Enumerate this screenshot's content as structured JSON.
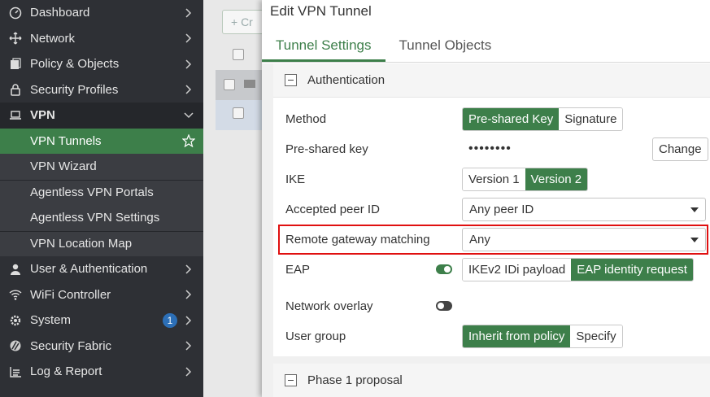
{
  "sidebar": {
    "items": [
      {
        "label": "Dashboard",
        "icon": "dashboard-icon"
      },
      {
        "label": "Network",
        "icon": "network-icon"
      },
      {
        "label": "Policy & Objects",
        "icon": "policy-icon"
      },
      {
        "label": "Security Profiles",
        "icon": "lock-icon"
      },
      {
        "label": "VPN",
        "icon": "laptop-icon"
      },
      {
        "label": "VPN Tunnels"
      },
      {
        "label": "VPN Wizard"
      },
      {
        "label": "Agentless VPN Portals"
      },
      {
        "label": "Agentless VPN Settings"
      },
      {
        "label": "VPN Location Map"
      },
      {
        "label": "User & Authentication",
        "icon": "user-icon"
      },
      {
        "label": "WiFi Controller",
        "icon": "wifi-icon"
      },
      {
        "label": "System",
        "icon": "gear-icon",
        "badge": "1"
      },
      {
        "label": "Security Fabric",
        "icon": "fabric-icon"
      },
      {
        "label": "Log & Report",
        "icon": "report-icon"
      }
    ]
  },
  "background": {
    "create_label": "+ Cr"
  },
  "dialog": {
    "title": "Edit VPN Tunnel",
    "tabs": [
      "Tunnel Settings",
      "Tunnel Objects"
    ],
    "auth_section": "Authentication",
    "phase1_section": "Phase 1 proposal",
    "fields": {
      "method": {
        "label": "Method",
        "options": [
          "Pre-shared Key",
          "Signature"
        ]
      },
      "psk": {
        "label": "Pre-shared key",
        "value": "••••••••",
        "button": "Change"
      },
      "ike": {
        "label": "IKE",
        "options": [
          "Version 1",
          "Version 2"
        ]
      },
      "peer": {
        "label": "Accepted peer ID",
        "value": "Any peer ID"
      },
      "gateway": {
        "label": "Remote gateway matching",
        "value": "Any"
      },
      "eap": {
        "label": "EAP",
        "options": [
          "IKEv2 IDi payload",
          "EAP identity request"
        ]
      },
      "overlay": {
        "label": "Network overlay"
      },
      "usergroup": {
        "label": "User group",
        "options": [
          "Inherit from policy",
          "Specify"
        ]
      }
    }
  },
  "colors": {
    "accent": "#3d7f4a",
    "highlight": "#e01010",
    "sidebar": "#2e3035"
  }
}
